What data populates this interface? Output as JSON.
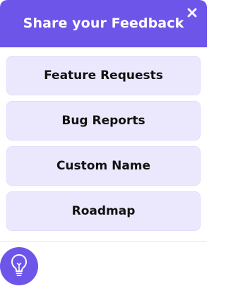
{
  "header": {
    "title": "Share your Feedback",
    "close_icon": "close-icon"
  },
  "menu": {
    "items": [
      {
        "label": "Feature Requests"
      },
      {
        "label": "Bug Reports"
      },
      {
        "label": "Custom Name"
      },
      {
        "label": "Roadmap"
      }
    ]
  },
  "launcher": {
    "icon": "lightbulb-icon"
  },
  "colors": {
    "accent": "#6e55ea",
    "item_background": "#ebe8fd",
    "text": "#111111",
    "header_text": "#ffffff"
  }
}
